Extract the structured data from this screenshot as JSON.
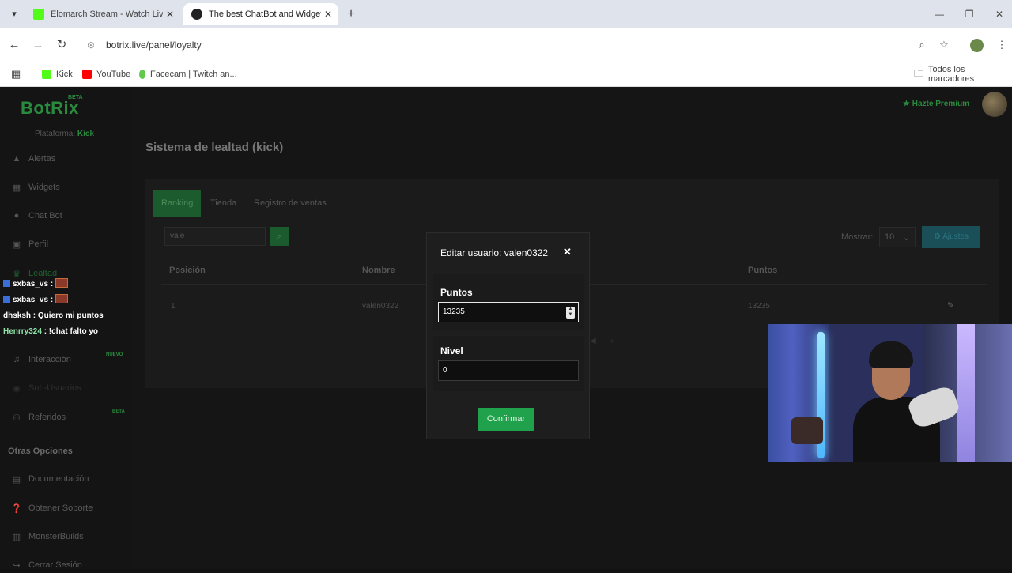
{
  "browser": {
    "tabs": [
      {
        "title": "Elomarch Stream - Watch Live o",
        "favicon_color": "#53fc18"
      },
      {
        "title": "The best ChatBot and Widgets f",
        "favicon_color": "#222222"
      }
    ],
    "url": "botrix.live/panel/loyalty",
    "bookmarks": [
      {
        "label": "Kick",
        "color": "#53fc18"
      },
      {
        "label": "YouTube",
        "color": "#ff0000"
      },
      {
        "label": "Facecam | Twitch an...",
        "color": "#63c94b"
      }
    ],
    "all_bookmarks": "Todos los marcadores"
  },
  "app": {
    "logo": "BotRix",
    "logo_badge": "BETA",
    "platform_label": "Plataforma:",
    "platform_value": "Kick",
    "premium_label": "Hazte Premium",
    "sidebar": {
      "items": [
        {
          "label": "Alertas",
          "icon": "warning-icon"
        },
        {
          "label": "Widgets",
          "icon": "grid-icon"
        },
        {
          "label": "Chat Bot",
          "icon": "bot-icon"
        },
        {
          "label": "Perfil",
          "icon": "profile-icon"
        },
        {
          "label": "Lealtad",
          "icon": "trophy-icon"
        },
        {
          "label": "Interacción",
          "icon": "music-icon",
          "badge": "NUEVO"
        },
        {
          "label": "Sub-Usuarios",
          "icon": "users-icon"
        },
        {
          "label": "Referidos",
          "icon": "referral-icon",
          "badge": "BETA"
        }
      ],
      "other_heading": "Otras Opciones",
      "other_items": [
        {
          "label": "Documentación",
          "icon": "book-icon"
        },
        {
          "label": "Obtener Soporte",
          "icon": "help-icon"
        },
        {
          "label": "MonsterBuilds",
          "icon": "monster-icon"
        },
        {
          "label": "Cerrar Sesión",
          "icon": "logout-icon"
        }
      ]
    },
    "page_title": "Sistema de lealtad (kick)",
    "tabs": [
      "Ranking",
      "Tienda",
      "Registro de ventas"
    ],
    "search_value": "vale",
    "mostrar_label": "Mostrar:",
    "mostrar_value": "10",
    "ajustes_label": "Ajustes",
    "table": {
      "headers": [
        "Posición",
        "Nombre",
        "Puntos"
      ],
      "rows": [
        {
          "position": "1",
          "name": "valen0322",
          "points": "13235"
        }
      ]
    }
  },
  "chat": [
    {
      "user": "sxbas_vs",
      "message": ":",
      "user_color": "#ffffff"
    },
    {
      "user": "sxbas_vs",
      "message": ":",
      "user_color": "#ffffff"
    },
    {
      "user": "dhsksh",
      "message": ": Quiero mi puntos",
      "user_color": "#ffffff"
    },
    {
      "user": "Henrry324",
      "message": ": !chat falto yo",
      "user_color": "#8fe3a8"
    }
  ],
  "modal": {
    "title": "Editar usuario: valen0322",
    "points_label": "Puntos",
    "points_value": "13235",
    "level_label": "Nivel",
    "level_value": "0",
    "confirm_label": "Confirmar"
  }
}
